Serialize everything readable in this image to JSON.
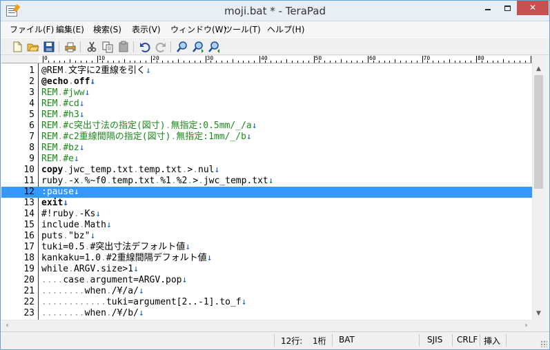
{
  "window": {
    "title": "moji.bat * - TeraPad",
    "minimize": "",
    "maximize": "",
    "close": "✕"
  },
  "menu": [
    {
      "label": "ファイル(F)"
    },
    {
      "label": "編集(E)"
    },
    {
      "label": "検索(S)"
    },
    {
      "label": "表示(V)"
    },
    {
      "label": "ウィンドウ(W)"
    },
    {
      "label": "ツール(T)"
    },
    {
      "label": "ヘルプ(H)"
    }
  ],
  "toolbar": [
    {
      "icon": "new-file-icon"
    },
    {
      "icon": "open-folder-icon"
    },
    {
      "icon": "save-icon"
    },
    {
      "icon": "print-icon"
    },
    {
      "icon": "cut-icon"
    },
    {
      "icon": "copy-icon"
    },
    {
      "icon": "paste-icon"
    },
    {
      "icon": "undo-icon"
    },
    {
      "icon": "redo-icon"
    },
    {
      "icon": "find-icon"
    },
    {
      "icon": "find-next-icon"
    },
    {
      "icon": "find-prev-icon"
    }
  ],
  "ruler": {
    "labels": [
      "0",
      "10",
      "20",
      "30",
      "40",
      "50",
      "60",
      "70",
      "80"
    ]
  },
  "editor": {
    "current_line": 12,
    "lines": [
      {
        "n": "1",
        "text": "@REM␣文字に2重線を引く↓",
        "style": "normal"
      },
      {
        "n": "2",
        "text": "@echo␣off↓",
        "style": "bold"
      },
      {
        "n": "3",
        "text": "REM␣#jww↓",
        "style": "comment"
      },
      {
        "n": "4",
        "text": "REM␣#cd↓",
        "style": "comment"
      },
      {
        "n": "5",
        "text": "REM␣#h3↓",
        "style": "comment"
      },
      {
        "n": "6",
        "text": "REM␣#c突出寸法の指定(図寸)␣無指定:0.5mm/_/a↓",
        "style": "comment"
      },
      {
        "n": "7",
        "text": "REM␣#c2重線間隔の指定(図寸)␣無指定:1mm/_/b↓",
        "style": "comment"
      },
      {
        "n": "8",
        "text": "REM␣#bz↓",
        "style": "comment"
      },
      {
        "n": "9",
        "text": "REM␣#e↓",
        "style": "comment"
      },
      {
        "n": "10",
        "text": "copy␣jwc_temp.txt␣temp.txt␣>␣nul↓",
        "style": "bold-first"
      },
      {
        "n": "11",
        "text": "ruby␣-x␣%~f0␣temp.txt␣%1␣%2␣>␣jwc_temp.txt↓",
        "style": "normal"
      },
      {
        "n": "12",
        "text": ":pause↓",
        "style": "normal"
      },
      {
        "n": "13",
        "text": "exit↓",
        "style": "bold"
      },
      {
        "n": "14",
        "text": "#!ruby␣-Ks↓",
        "style": "normal"
      },
      {
        "n": "15",
        "text": "include␣Math↓",
        "style": "normal"
      },
      {
        "n": "16",
        "text": "puts␣\"bz\"↓",
        "style": "normal"
      },
      {
        "n": "17",
        "text": "tuki=0.5␣#突出寸法デフォルト値↓",
        "style": "normal"
      },
      {
        "n": "18",
        "text": "kankaku=1.0␣#2重線間隔デフォルト値↓",
        "style": "normal"
      },
      {
        "n": "19",
        "text": "while␣ARGV.size>1↓",
        "style": "normal"
      },
      {
        "n": "20",
        "text": "␣␣␣␣case␣argument=ARGV.pop↓",
        "style": "normal"
      },
      {
        "n": "21",
        "text": "␣␣␣␣␣␣␣␣when␣/¥/a/↓",
        "style": "normal"
      },
      {
        "n": "22",
        "text": "␣␣␣␣␣␣␣␣␣␣␣␣tuki=argument[2..-1].to_f↓",
        "style": "normal"
      },
      {
        "n": "23",
        "text": "␣␣␣␣␣␣␣␣when␣/¥/b/↓",
        "style": "normal"
      }
    ]
  },
  "statusbar": {
    "line": "12行:",
    "col": "1桁",
    "type": "BAT",
    "encoding": "SJIS",
    "newline": "CRLF",
    "mode": "挿入"
  }
}
